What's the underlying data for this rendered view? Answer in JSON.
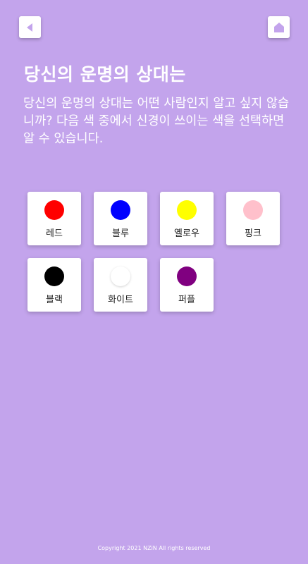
{
  "header": {
    "back_icon": "back-arrow-icon",
    "home_icon": "home-icon"
  },
  "title": "당신의 운명의 상대는",
  "description": "당신의 운명의 상대는 어떤 사람인지 알고 싶지 않습니까? 다음 색 중에서 신경이 쓰이는 색을 선택하면 알 수 있습니다.",
  "colors": [
    {
      "label": "레드",
      "hex": "#ff0000"
    },
    {
      "label": "블루",
      "hex": "#0000ff"
    },
    {
      "label": "옐로우",
      "hex": "#ffff00"
    },
    {
      "label": "핑크",
      "hex": "#ffc0cb"
    },
    {
      "label": "블랙",
      "hex": "#000000"
    },
    {
      "label": "화이트",
      "hex": "#ffffff"
    },
    {
      "label": "퍼플",
      "hex": "#800080"
    }
  ],
  "footer": "Copyright 2021 NZiN All rights reserved",
  "theme": {
    "background": "#c3a4ec",
    "card": "#ffffff",
    "nav_icon": "#c3a4ec"
  }
}
